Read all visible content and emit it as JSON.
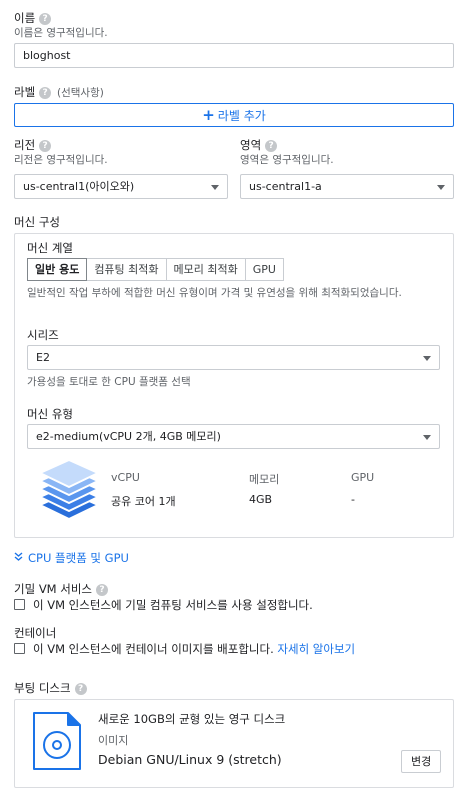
{
  "name": {
    "label": "이름",
    "sub": "이름은 영구적입니다.",
    "value": "bloghost"
  },
  "labels": {
    "label": "라벨",
    "optional": "(선택사항)",
    "add_button": "라벨 추가"
  },
  "region": {
    "label": "리전",
    "sub": "리전은 영구적입니다.",
    "value": "us-central1(아이오와)"
  },
  "zone": {
    "label": "영역",
    "sub": "영역은 영구적입니다.",
    "value": "us-central1-a"
  },
  "machine": {
    "section_label": "머신 구성",
    "family_label": "머신 계열",
    "tabs": [
      "일반 용도",
      "컴퓨팅 최적화",
      "메모리 최적화",
      "GPU"
    ],
    "description": "일반적인 작업 부하에 적합한 머신 유형이며 가격 및 유연성을 위해 최적화되었습니다.",
    "series_label": "시리즈",
    "series_value": "E2",
    "series_hint": "가용성을 토대로 한 CPU 플랫폼 선택",
    "type_label": "머신 유형",
    "type_value": "e2-medium(vCPU 2개, 4GB 메모리)",
    "specs": {
      "vcpu_header": "vCPU",
      "memory_header": "메모리",
      "gpu_header": "GPU",
      "vcpu_value": "공유 코어 1개",
      "memory_value": "4GB",
      "gpu_value": "-"
    }
  },
  "cpu_platform": {
    "label": "CPU 플랫폼 및 GPU"
  },
  "confidential": {
    "label": "기밀 VM 서비스",
    "checkbox": "이 VM 인스턴스에 기밀 컴퓨팅 서비스를 사용 설정합니다."
  },
  "container": {
    "label": "컨테이너",
    "checkbox": "이 VM 인스턴스에 컨테이너 이미지를 배포합니다.",
    "learn_more": "자세히 알아보기"
  },
  "boot_disk": {
    "label": "부팅 디스크",
    "title": "새로운 10GB의 균형 있는 영구 디스크",
    "image_label": "이미지",
    "image_value": "Debian GNU/Linux 9 (stretch)",
    "change_button": "변경"
  },
  "colors": {
    "accent": "#1a73e8",
    "border": "#dadce0",
    "text": "#202124",
    "subtext": "#5f6368"
  }
}
